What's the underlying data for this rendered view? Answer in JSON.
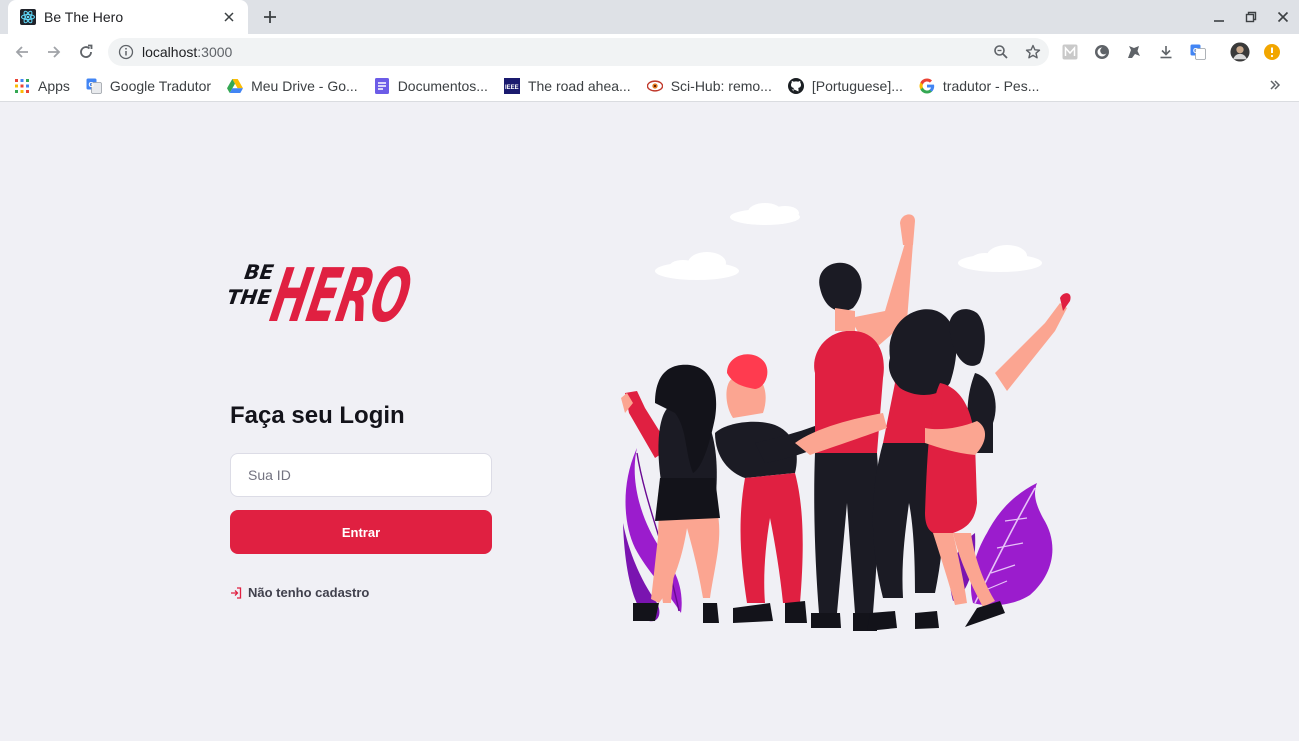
{
  "browser": {
    "tab_title": "Be The Hero",
    "url_host": "localhost",
    "url_port": ":3000"
  },
  "bookmarks": [
    {
      "label": "Apps",
      "icon": "apps-grid-icon"
    },
    {
      "label": "Google Tradutor",
      "icon": "google-translate-icon"
    },
    {
      "label": "Meu Drive - Go...",
      "icon": "google-drive-icon"
    },
    {
      "label": "Documentos...",
      "icon": "google-docs-icon"
    },
    {
      "label": "The road ahea...",
      "icon": "ieee-icon"
    },
    {
      "label": "Sci-Hub: remo...",
      "icon": "scihub-icon"
    },
    {
      "label": "[Portuguese]...",
      "icon": "github-icon"
    },
    {
      "label": "tradutor - Pes...",
      "icon": "google-icon"
    }
  ],
  "logo": {
    "line1": "BE",
    "line2": "THE",
    "word": "HERO"
  },
  "login": {
    "title": "Faça seu Login",
    "id_placeholder": "Sua ID",
    "submit_label": "Entrar",
    "register_label": "Não tenho cadastro"
  },
  "colors": {
    "brand_red": "#e02041",
    "page_bg": "#f0f0f5",
    "heading": "#13131a"
  }
}
